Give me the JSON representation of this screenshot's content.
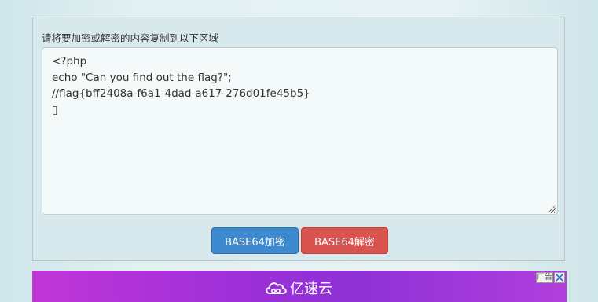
{
  "form": {
    "instruction": "请将要加密或解密的内容复制到以下区域",
    "content_lines": [
      "<?php",
      "echo \"Can you find out the flag?\";",
      "//flag{bff2408a-f6a1-4dad-a617-276d01fe45b5}",
      "▯"
    ]
  },
  "buttons": {
    "encode_label": "BASE64加密",
    "decode_label": "BASE64解密"
  },
  "ad": {
    "brand": "亿速云",
    "tag": "广告",
    "close_icon": "close-icon",
    "brand_icon": "cloud-icon"
  },
  "colors": {
    "encode_button": "#3d8ad0",
    "decode_button": "#d9534f",
    "ad_gradient_start": "#c137d8",
    "ad_gradient_end": "#8e31d6"
  }
}
